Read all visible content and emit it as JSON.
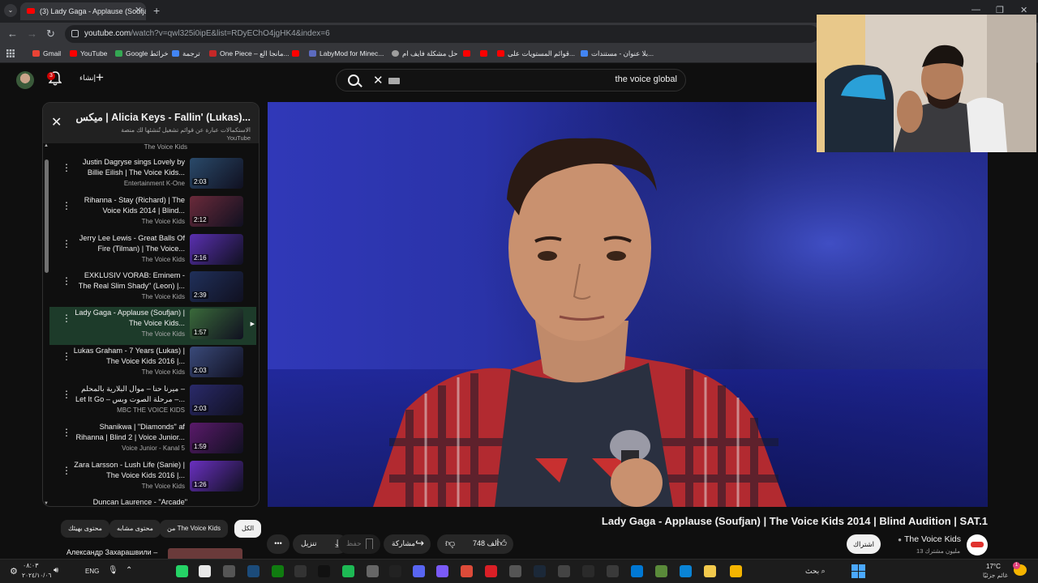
{
  "browser": {
    "tab_title": "(3) Lady Gaga - Applause (Soufjan)",
    "tab_close": "✕",
    "new_tab": "+",
    "tab_list": "⌄",
    "win_min": "—",
    "win_max": "❐",
    "win_close": "✕",
    "url_host": "youtube.com",
    "url_rest": "/watch?v=qwl325i0ipE&list=RDyEChO4jgHK4&index=6",
    "nav_back": "←",
    "nav_forward": "→",
    "nav_reload": "↻",
    "bookmarks": [
      {
        "label": "Gmail",
        "color": "#ea4335"
      },
      {
        "label": "YouTube",
        "color": "#ff0000"
      },
      {
        "label": "Google خرائط",
        "color": "#34a853"
      },
      {
        "label": "ترجمة",
        "color": "#4285f4"
      },
      {
        "label": "One Piece – مانجا الع...",
        "color": "#c62828"
      },
      {
        "label": "",
        "color": "#ff0000"
      },
      {
        "label": "LabyMod for Minec...",
        "color": "#5c6bc0"
      },
      {
        "label": "حل مشكلة فايف ام",
        "color": "#9e9e9e"
      },
      {
        "label": "",
        "color": "#ff0000"
      },
      {
        "label": "",
        "color": "#ff0000"
      },
      {
        "label": "قوائم المستويات على...",
        "color": "#ff0000"
      },
      {
        "label": "بلا عنوان - مستندات...",
        "color": "#4285f4"
      }
    ]
  },
  "header": {
    "search_query": "the voice global",
    "create_label": "إنشاء",
    "notif_count": "3"
  },
  "playlist": {
    "title": "ميكس | Alicia Keys - Fallin' (Lukas)...",
    "subtitle_line1": "الاستكمالات عبارة عن قوائم تشغيل تُنشئها لك منصة",
    "subtitle_line2": "YouTube",
    "close": "✕",
    "partial_top_channel": "The Voice Kids",
    "items": [
      {
        "title": "Justin Dagryse sings Lovely by Billie Eilish | The Voice Kids...",
        "channel": "Entertainment K-One",
        "duration": "2:03",
        "thumb": "#2a4a6a",
        "active": false
      },
      {
        "title": "Rihanna - Stay (Richard) | The Voice Kids 2014 | Blind...",
        "channel": "The Voice Kids",
        "duration": "2:12",
        "thumb": "#6a2a3a",
        "active": false
      },
      {
        "title": "Jerry Lee Lewis - Great Balls Of Fire (Tilman) | The Voice...",
        "channel": "The Voice Kids",
        "duration": "2:16",
        "thumb": "#5a30b0",
        "active": false
      },
      {
        "title": "EXKLUSIV VORAB: Eminem - The Real Slim Shady\" (Leon) |...",
        "channel": "The Voice Kids",
        "duration": "2:39",
        "thumb": "#20305a",
        "active": false
      },
      {
        "title": "Lady Gaga - Applause (Soufjan) | The Voice Kids...",
        "channel": "The Voice Kids",
        "duration": "1:57",
        "thumb": "#3a6a3a",
        "active": true
      },
      {
        "title": "Lukas Graham - 7 Years (Lukas) | The Voice Kids 2016 |...",
        "channel": "The Voice Kids",
        "duration": "2:03",
        "thumb": "#3a4a7a",
        "active": false
      },
      {
        "title": "ميرنا حنا – موال البلارية بالمحلم – Let It Go – مرحلة الصوت وبس –...",
        "channel": "MBC THE VOICE KIDS",
        "duration": "2:03",
        "thumb": "#2a2a6a",
        "active": false
      },
      {
        "title": "Shanikwa | \"Diamonds\" af Rihanna | Blind 2 | Voice Junior...",
        "channel": "Voice Junior - Kanal 5",
        "duration": "1:59",
        "thumb": "#5a1a6a",
        "active": false
      },
      {
        "title": "Zara Larsson - Lush Life (Sanie) | The Voice Kids 2016 |...",
        "channel": "The Voice Kids",
        "duration": "1:26",
        "thumb": "#6a30c0",
        "active": false
      }
    ],
    "partial_bottom_title": "Duncan Laurence - \"Arcade\""
  },
  "video": {
    "title": "Lady Gaga - Applause (Soufjan) | The Voice Kids 2014 | Blind Audition | SAT.1"
  },
  "chips": [
    {
      "label": "الكل",
      "selected": true
    },
    {
      "label": "من The Voice Kids",
      "selected": false
    },
    {
      "label": "محتوى مشابه",
      "selected": false
    },
    {
      "label": "محتوى بهيئك",
      "selected": false
    }
  ],
  "actions": {
    "more": "•••",
    "download": "تنزيل",
    "save": "حفظ",
    "share": "مشاركة",
    "likes": "748 ألف"
  },
  "channel": {
    "name": "The Voice Kids",
    "subs": "13 مليون مشترك",
    "subscribe": "اشتراك"
  },
  "next_peek": "Александр Захарашвили –",
  "taskbar": {
    "time": "٠٨:٠٣",
    "date": "٢٠٢٤/١٠/٠٦",
    "lang": "ENG",
    "search": "بحث",
    "weather_temp": "17°C",
    "weather_desc": "غائم جزئيًا",
    "weather_badge": "1"
  }
}
